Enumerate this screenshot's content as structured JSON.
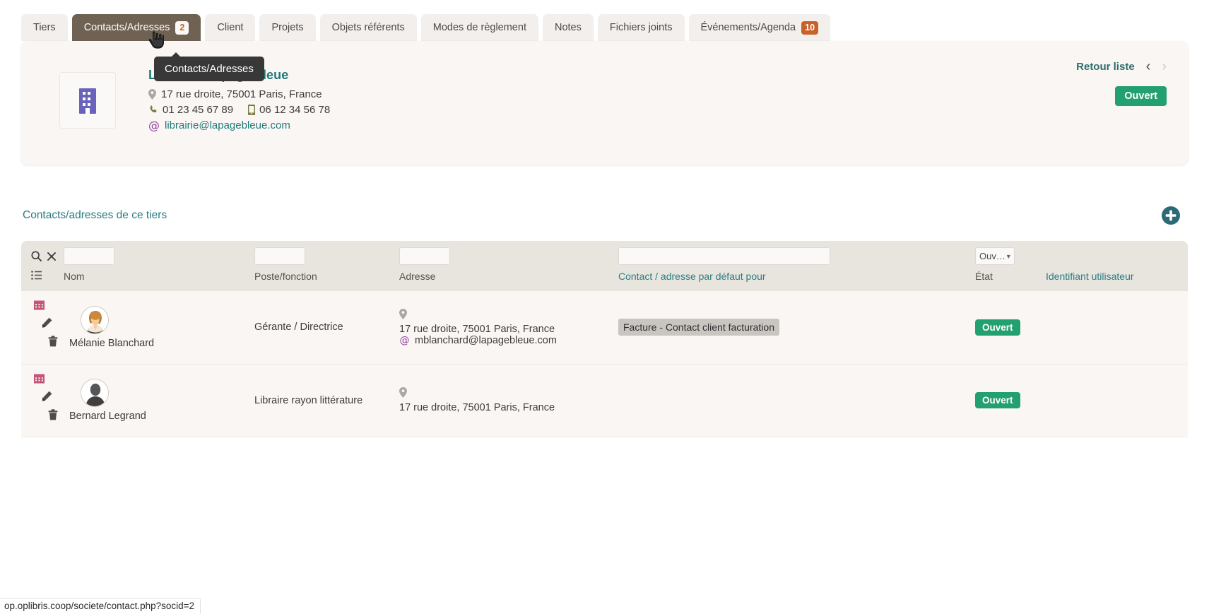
{
  "tabs": [
    {
      "label": "Tiers",
      "badge": null,
      "active": false
    },
    {
      "label": "Contacts/Adresses",
      "badge": "2",
      "active": true
    },
    {
      "label": "Client",
      "badge": null,
      "active": false
    },
    {
      "label": "Projets",
      "badge": null,
      "active": false
    },
    {
      "label": "Objets référents",
      "badge": null,
      "active": false
    },
    {
      "label": "Modes de règlement",
      "badge": null,
      "active": false
    },
    {
      "label": "Notes",
      "badge": null,
      "active": false
    },
    {
      "label": "Fichiers joints",
      "badge": null,
      "active": false
    },
    {
      "label": "Événements/Agenda",
      "badge": "10",
      "active": false
    }
  ],
  "tooltip": {
    "text": "Contacts/Adresses"
  },
  "banner": {
    "title": "Librairie La page bleue",
    "address": "17 rue droite, 75001 Paris, France",
    "phone": "01 23 45 67 89",
    "mobile": "06 12 34 56 78",
    "email": "librairie@lapagebleue.com",
    "back_label": "Retour liste",
    "status": "Ouvert"
  },
  "section": {
    "title": "Contacts/adresses de ce tiers",
    "add_button_title": "Ajouter"
  },
  "table": {
    "filters": {
      "nom": "",
      "poste": "",
      "adresse": "",
      "defaut": "",
      "etat_selected": "Ouv…"
    },
    "columns": [
      "Nom",
      "Poste/fonction",
      "Adresse",
      "Contact / adresse par défaut pour",
      "État",
      "Identifiant utilisateur"
    ],
    "rows": [
      {
        "name": "Mélanie Blanchard",
        "avatar": "woman-avatar",
        "poste": "Gérante / Directrice",
        "address": "17 rue droite, 75001 Paris, France",
        "email": "mblanchard@lapagebleue.com",
        "default_for": "Facture - Contact client facturation",
        "etat": "Ouvert",
        "identifiant": ""
      },
      {
        "name": "Bernard Legrand",
        "avatar": "generic-avatar",
        "poste": "Libraire rayon littérature",
        "address": "17 rue droite, 75001 Paris, France",
        "email": "",
        "default_for": "",
        "etat": "Ouvert",
        "identifiant": ""
      }
    ]
  },
  "statusbar": {
    "url": "op.oplibris.coop/societe/contact.php?socid=2"
  },
  "colors": {
    "active_tab": "#6f6253",
    "badge_orange": "#c9622a",
    "teal": "#2b7d82",
    "green": "#23a06f",
    "purple": "#6b63bb",
    "olive": "#7a7a3c",
    "pink": "#c75a7d"
  }
}
